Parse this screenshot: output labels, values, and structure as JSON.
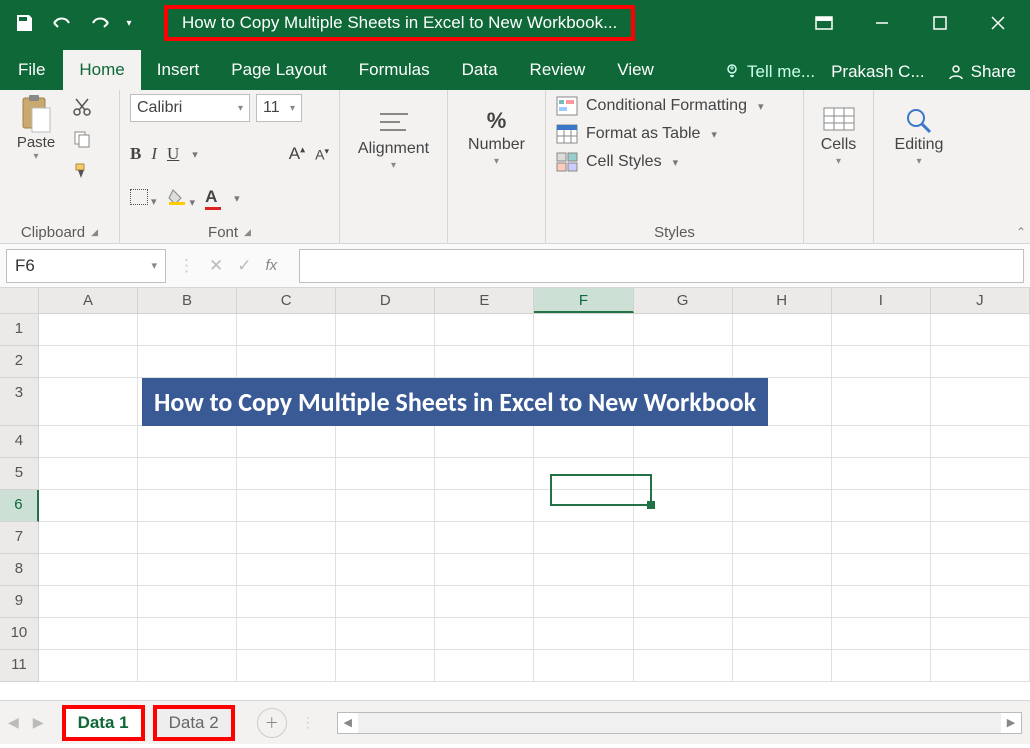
{
  "title": "How to Copy Multiple Sheets in Excel to New Workbook...",
  "account": "Prakash C...",
  "share": "Share",
  "tabs": {
    "file": "File",
    "home": "Home",
    "insert": "Insert",
    "pageLayout": "Page Layout",
    "formulas": "Formulas",
    "data": "Data",
    "review": "Review",
    "view": "View",
    "tellme": "Tell me..."
  },
  "ribbon": {
    "clipboard": {
      "paste": "Paste",
      "label": "Clipboard"
    },
    "font": {
      "name": "Calibri",
      "size": "11",
      "label": "Font",
      "bold": "B",
      "italic": "I",
      "underline": "U",
      "grow": "A",
      "shrink": "A"
    },
    "alignment": {
      "label": "Alignment"
    },
    "number": {
      "percent": "%",
      "label": "Number"
    },
    "styles": {
      "cond": "Conditional Formatting",
      "table": "Format as Table",
      "cell": "Cell Styles",
      "label": "Styles"
    },
    "cells": {
      "label": "Cells"
    },
    "editing": {
      "label": "Editing"
    }
  },
  "namebox": "F6",
  "fx": "fx",
  "columns": [
    "A",
    "B",
    "C",
    "D",
    "E",
    "F",
    "G",
    "H",
    "I",
    "J"
  ],
  "rows": [
    "1",
    "2",
    "3",
    "4",
    "5",
    "6",
    "7",
    "8",
    "9",
    "10",
    "11"
  ],
  "banner": "How to Copy Multiple Sheets in Excel to New Workbook",
  "selectedColIndex": 5,
  "selectedRowIndex": 5,
  "sheets": {
    "active": "Data 1",
    "inactive": "Data 2"
  }
}
